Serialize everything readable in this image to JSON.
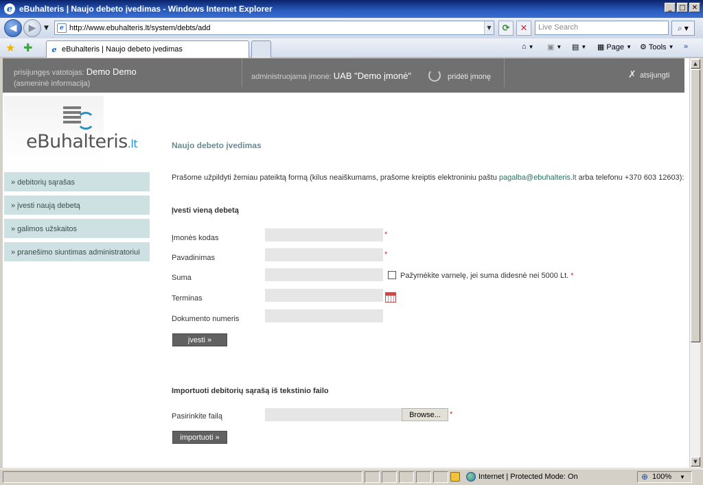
{
  "window": {
    "title": "eBuhalteris | Naujo debeto įvedimas - Windows Internet Explorer",
    "min": "_",
    "max": "□",
    "close": "✕"
  },
  "nav": {
    "back_icon": "back-arrow-icon",
    "forward_icon": "forward-arrow-icon",
    "url": "http://www.ebuhalteris.lt/system/debts/add",
    "search_placeholder": "Live Search"
  },
  "tab": {
    "label": "eBuhalteris | Naujo debeto įvedimas"
  },
  "commands": {
    "page": "Page",
    "tools": "Tools"
  },
  "header": {
    "user_label": "prisijungęs vatotojas:",
    "user_name": "Demo Demo",
    "personal_info": "(asmeninė informacija)",
    "company_label": "administruojama įmonė:",
    "company_name": "UAB \"Demo įmonė\"",
    "add_company": "pridėti įmonę",
    "logout": "atsijungti"
  },
  "logo": {
    "main": "eBuhalteris",
    "suffix": ".lt"
  },
  "sidebar": {
    "items": [
      {
        "label": "» debitorių sąrašas"
      },
      {
        "label": "» įvesti naują debetą"
      },
      {
        "label": "» galimos užskaitos"
      },
      {
        "label": "» pranešimo siuntimas administratoriui"
      }
    ]
  },
  "content": {
    "page_title": "Naujo debeto įvedimas",
    "intro_before": "Prašome užpildyti žemiau pateiktą formą (kilus neaiškumams, prašome kreiptis elektroniniu paštu ",
    "intro_email": "pagalba@ebuhalteris.lt",
    "intro_after": " arba telefonu +370 603 12603):",
    "single_title": "Įvesti vieną debetą",
    "fields": {
      "company_code": "Įmonės kodas",
      "name": "Pavadinimas",
      "amount": "Suma",
      "term": "Terminas",
      "doc_number": "Dokumento numeris"
    },
    "checkbox_label": "Pažymėkite varnelę, jei suma didesnė nei 5000 Lt.",
    "required_mark": "*",
    "submit": "įvesti »",
    "import_title": "Importuoti debitorių sąrašą iš tekstinio failo",
    "file_label": "Pasirinkite failą",
    "browse": "Browse...",
    "import_btn": "importuoti »"
  },
  "status": {
    "zone": "Internet | Protected Mode: On",
    "zoom": "100%"
  }
}
